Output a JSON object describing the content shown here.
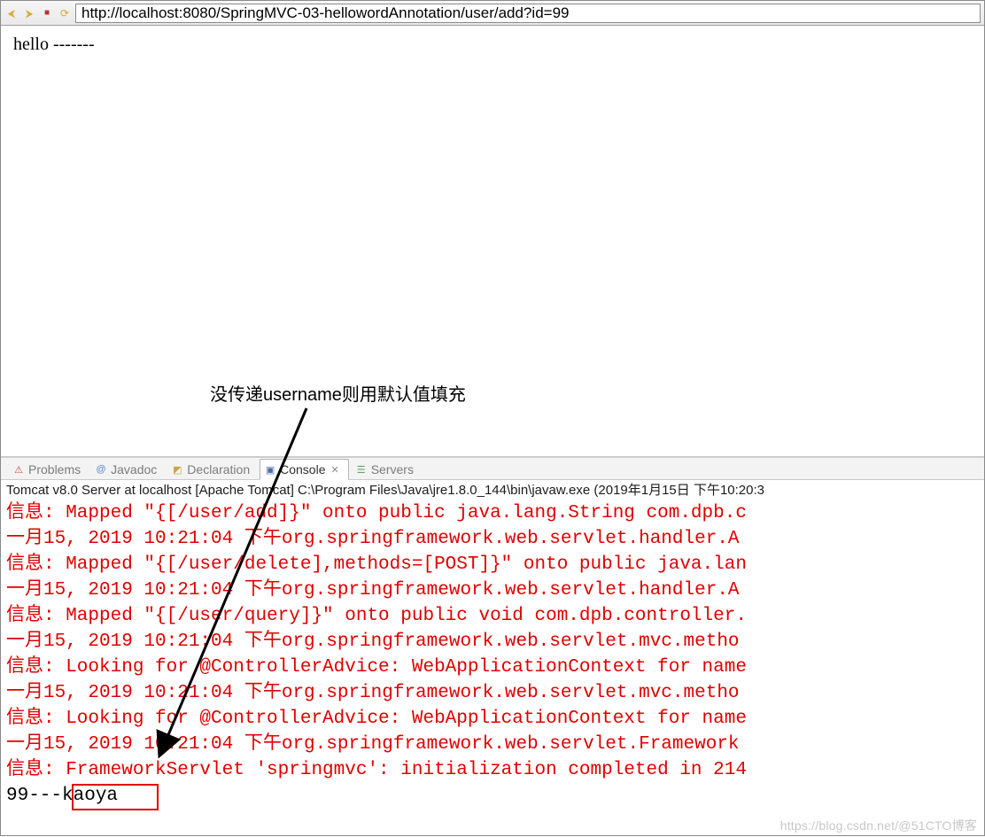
{
  "toolbar": {
    "url": "http://localhost:8080/SpringMVC-03-hellowordAnnotation/user/add?id=99"
  },
  "page": {
    "body_text": "hello -------"
  },
  "annotation": {
    "text": "没传递username则用默认值填充"
  },
  "ide_tabs": {
    "problems": "Problems",
    "javadoc": "Javadoc",
    "declaration": "Declaration",
    "console": "Console",
    "servers": "Servers"
  },
  "server_line": "Tomcat v8.0 Server at localhost [Apache Tomcat] C:\\Program Files\\Java\\jre1.8.0_144\\bin\\javaw.exe (2019年1月15日 下午10:20:3",
  "console_lines": [
    {
      "cls": "err",
      "text": "信息: Mapped \"{[/user/add]}\" onto public java.lang.String com.dpb.c"
    },
    {
      "cls": "err",
      "text": "一月15, 2019 10:21:04 下午org.springframework.web.servlet.handler.A"
    },
    {
      "cls": "err",
      "text": "信息: Mapped \"{[/user/delete],methods=[POST]}\" onto public java.lan"
    },
    {
      "cls": "err",
      "text": "一月15, 2019 10:21:04 下午org.springframework.web.servlet.handler.A"
    },
    {
      "cls": "err",
      "text": "信息: Mapped \"{[/user/query]}\" onto public void com.dpb.controller."
    },
    {
      "cls": "err",
      "text": "一月15, 2019 10:21:04 下午org.springframework.web.servlet.mvc.metho"
    },
    {
      "cls": "err",
      "text": "信息: Looking for @ControllerAdvice: WebApplicationContext for name"
    },
    {
      "cls": "err",
      "text": "一月15, 2019 10:21:04 下午org.springframework.web.servlet.mvc.metho"
    },
    {
      "cls": "err",
      "text": "信息: Looking for @ControllerAdvice: WebApplicationContext for name"
    },
    {
      "cls": "err",
      "text": "一月15, 2019 10:21:04 下午org.springframework.web.servlet.Framework"
    },
    {
      "cls": "err",
      "text": "信息: FrameworkServlet 'springmvc': initialization completed in 214"
    },
    {
      "cls": "out",
      "text": "99---kaoya"
    }
  ],
  "watermark": "https://blog.csdn.net/@51CTO博客",
  "colors": {
    "console_error": "#e00000",
    "highlight_box": "#e00000"
  }
}
